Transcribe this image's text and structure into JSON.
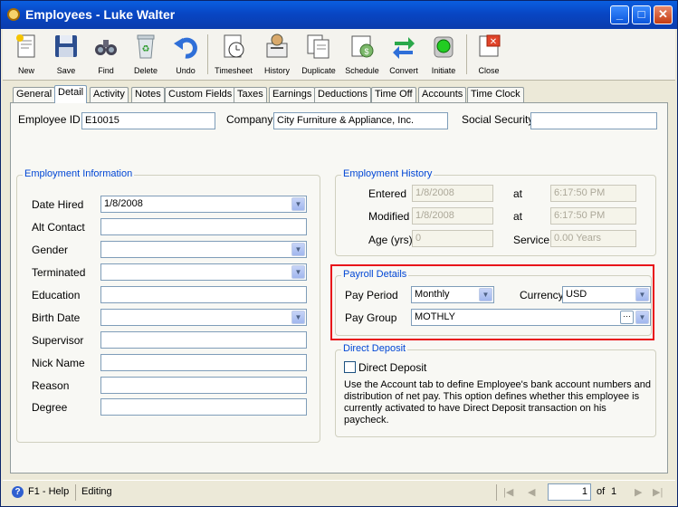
{
  "window": {
    "title": "Employees - Luke  Walter",
    "buttons": [
      "_",
      "□",
      "✕"
    ]
  },
  "toolbar": {
    "items": [
      {
        "label": "New",
        "icon": "new-doc-icon"
      },
      {
        "label": "Save",
        "icon": "floppy-disk-icon"
      },
      {
        "label": "Find",
        "icon": "binoculars-icon"
      },
      {
        "label": "Delete",
        "icon": "recycle-bin-icon"
      },
      {
        "label": "Undo",
        "icon": "undo-arrow-icon"
      },
      {
        "label": "Timesheet",
        "icon": "timesheet-icon"
      },
      {
        "label": "History",
        "icon": "history-icon"
      },
      {
        "label": "Duplicate",
        "icon": "duplicate-icon"
      },
      {
        "label": "Schedule",
        "icon": "schedule-icon"
      },
      {
        "label": "Convert",
        "icon": "convert-arrows-icon"
      },
      {
        "label": "Initiate",
        "icon": "traffic-light-icon"
      },
      {
        "label": "Close",
        "icon": "close-doc-icon"
      }
    ]
  },
  "tabs": [
    "General",
    "Detail",
    "Activity",
    "Notes",
    "Custom Fields",
    "Taxes",
    "Earnings",
    "Deductions",
    "Time Off",
    "Accounts",
    "Time Clock"
  ],
  "active_tab": "Detail",
  "header": {
    "employee_id_label": "Employee ID",
    "employee_id": "E10015",
    "company_label": "Company",
    "company": "City Furniture & Appliance, Inc.",
    "ssn_label": "Social Security",
    "ssn": ""
  },
  "employment_info": {
    "title": "Employment Information",
    "fields": [
      {
        "label": "Date Hired",
        "value": "1/8/2008",
        "dropdown": true
      },
      {
        "label": "Alt Contact",
        "value": "",
        "dropdown": false
      },
      {
        "label": "Gender",
        "value": "",
        "dropdown": true
      },
      {
        "label": "Terminated",
        "value": "",
        "dropdown": true
      },
      {
        "label": "Education",
        "value": "",
        "dropdown": false
      },
      {
        "label": "Birth Date",
        "value": "",
        "dropdown": true
      },
      {
        "label": "Supervisor",
        "value": "",
        "dropdown": false
      },
      {
        "label": "Nick Name",
        "value": "",
        "dropdown": false
      },
      {
        "label": "Reason",
        "value": "",
        "dropdown": false
      },
      {
        "label": "Degree",
        "value": "",
        "dropdown": false
      }
    ]
  },
  "employment_history": {
    "title": "Employment History",
    "entered_label": "Entered",
    "entered": "1/8/2008",
    "at1_label": "at",
    "entered_time": "6:17:50 PM",
    "modified_label": "Modified",
    "modified": "1/8/2008",
    "at2_label": "at",
    "modified_time": "6:17:50 PM",
    "age_label": "Age (yrs)",
    "age": "0",
    "service_label": "Service",
    "service": "0.00 Years"
  },
  "payroll": {
    "title": "Payroll Details",
    "pay_period_label": "Pay Period",
    "pay_period": "Monthly",
    "currency_label": "Currency",
    "currency": "USD",
    "pay_group_label": "Pay Group",
    "pay_group": "MOTHLY",
    "highlight_color": "#e8141a"
  },
  "direct_deposit": {
    "title": "Direct Deposit",
    "checkbox_label": "Direct Deposit",
    "description": "Use the Account tab to define Employee's bank account numbers and distribution of net pay. This option defines whether this employee is currently activated to have Direct Deposit transaction on his paycheck."
  },
  "status": {
    "help": "F1 - Help",
    "mode": "Editing",
    "page": "1",
    "of_label": "of",
    "total": "1"
  }
}
